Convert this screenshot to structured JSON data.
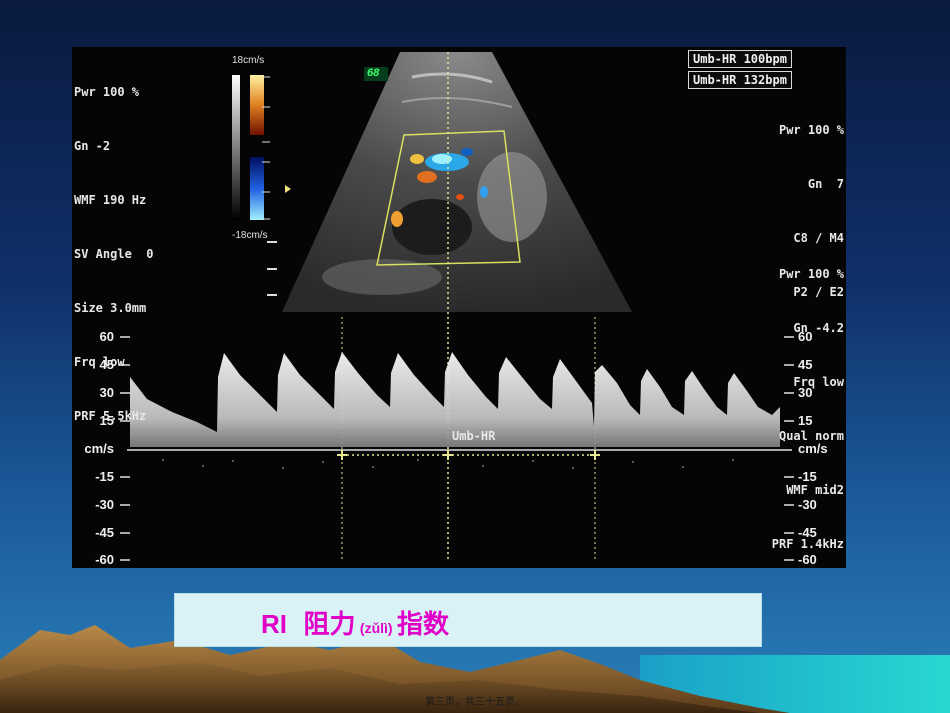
{
  "settings_left": [
    "Pwr 100 %",
    "Gn -2",
    "WMF 190 Hz",
    "SV Angle  0",
    "Size 3.0mm",
    "Frq low",
    "PRF 5.5kHz"
  ],
  "color_scale": {
    "top": "18cm/s",
    "bottom": "-18cm/s"
  },
  "frame_badge": "68",
  "heart_rates": [
    "Umb-HR 100bpm",
    "Umb-HR 132bpm"
  ],
  "settings_right_top": [
    "Pwr 100 %",
    "Gn  7",
    "C8 / M4",
    "P2 / E2"
  ],
  "settings_right_mid": [
    "Pwr 100 %",
    "Gn -4.2",
    "Frq low",
    "Qual norm",
    "WMF mid2",
    "PRF 1.4kHz"
  ],
  "velocity_axis": [
    "60",
    "45",
    "30",
    "15",
    "cm/s",
    "-15",
    "-30",
    "-45",
    "-60"
  ],
  "measure_label": "Umb-HR",
  "caption": {
    "term": "RI",
    "word": "阻力",
    "pinyin": "(zǔlì)",
    "suffix": "指数"
  },
  "footer": "第三页，共三十五页。",
  "colors": {
    "caption_text": "#e000c8",
    "caption_bg": "#d8f2f6",
    "cursor": "#e8e890",
    "doppler_box": "#d8e060"
  }
}
